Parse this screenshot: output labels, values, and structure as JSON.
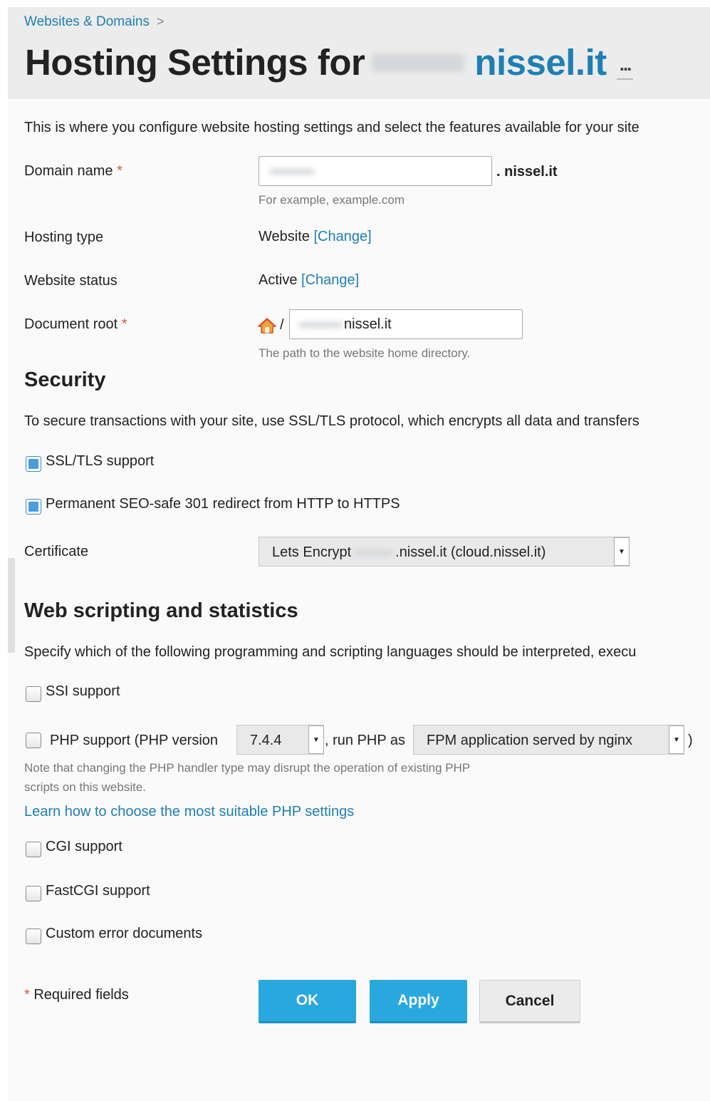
{
  "breadcrumb": {
    "label": "Websites & Domains",
    "separator": ">"
  },
  "header": {
    "title_prefix": "Hosting Settings for",
    "title_domain": "nissel.it",
    "more_label": "..."
  },
  "intro": "This is where you configure website hosting settings and select the features available for your site",
  "form": {
    "required_mark": "*",
    "domain_name": {
      "label": "Domain name",
      "suffix": ". nissel.it",
      "hint": "For example, example.com"
    },
    "hosting_type": {
      "label": "Hosting type",
      "value": "Website",
      "change_link": "[Change]"
    },
    "website_status": {
      "label": "Website status",
      "value": "Active",
      "change_link": "[Change]"
    },
    "document_root": {
      "label": "Document root",
      "separator": "/",
      "value": "nissel.it",
      "hint": "The path to the website home directory."
    }
  },
  "security": {
    "title": "Security",
    "description": "To secure transactions with your site, use SSL/TLS protocol, which encrypts all data and transfers",
    "ssl_support": {
      "label": "SSL/TLS support",
      "checked": true
    },
    "redirect": {
      "label": "Permanent SEO-safe 301 redirect from HTTP to HTTPS",
      "checked": true
    },
    "certificate": {
      "label": "Certificate",
      "value_prefix": "Lets Encrypt",
      "value_suffix": ".nissel.it (cloud.nissel.it)"
    }
  },
  "scripting": {
    "title": "Web scripting and statistics",
    "description": "Specify which of the following programming and scripting languages should be interpreted, execu",
    "ssi": {
      "label": "SSI support",
      "checked": false
    },
    "php": {
      "label": "PHP support (PHP version",
      "checked": false,
      "version": "7.4.4",
      "run_as_label": ", run PHP as",
      "handler": "FPM application served by nginx",
      "closing": ")",
      "note_line1": "Note that changing the PHP handler type may disrupt the operation of existing PHP",
      "note_line2": "scripts on this website.",
      "learn_link": "Learn how to choose the most suitable PHP settings"
    },
    "cgi": {
      "label": "CGI support",
      "checked": false
    },
    "fastcgi": {
      "label": "FastCGI support",
      "checked": false
    },
    "error_docs": {
      "label": "Custom error documents",
      "checked": false
    }
  },
  "footer": {
    "required_note": "Required fields",
    "ok_label": "OK",
    "apply_label": "Apply",
    "cancel_label": "Cancel"
  },
  "colors": {
    "link": "#1e7fb5",
    "primary_button": "#28a8df",
    "required": "#d9534f",
    "checkbox_checked": "#4a9de0"
  },
  "icons": {
    "home": "home-icon",
    "dropdown": "dropdown-arrow-icon"
  }
}
